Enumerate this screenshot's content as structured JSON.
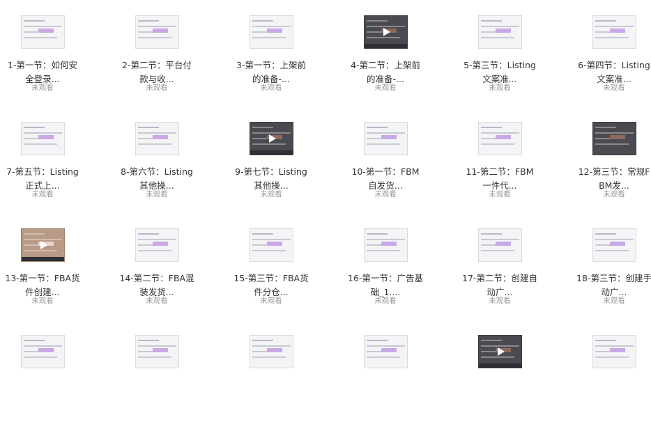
{
  "videos": [
    {
      "title": "1-第一节：如何安全登录...",
      "status": "未观看",
      "thumb": "light"
    },
    {
      "title": "2-第二节：平台付款与收...",
      "status": "未观看",
      "thumb": "light"
    },
    {
      "title": "3-第一节：上架前的准备-...",
      "status": "未观看",
      "thumb": "light"
    },
    {
      "title": "4-第二节：上架前的准备-...",
      "status": "未观看",
      "thumb": "dark-play"
    },
    {
      "title": "5-第三节：Listing文案准...",
      "status": "未观看",
      "thumb": "light"
    },
    {
      "title": "6-第四节：Listing文案准...",
      "status": "未观看",
      "thumb": "light"
    },
    {
      "title": "7-第五节：Listing正式上...",
      "status": "未观看",
      "thumb": "light"
    },
    {
      "title": "8-第六节：Listing其他操...",
      "status": "未观看",
      "thumb": "light"
    },
    {
      "title": "9-第七节：Listing其他操...",
      "status": "未观看",
      "thumb": "dark-play"
    },
    {
      "title": "10-第一节：FBM自发货...",
      "status": "未观看",
      "thumb": "light"
    },
    {
      "title": "11-第二节：FBM一件代...",
      "status": "未观看",
      "thumb": "light"
    },
    {
      "title": "12-第三节：常规FBM发...",
      "status": "未观看",
      "thumb": "dark"
    },
    {
      "title": "13-第一节：FBA货件创建...",
      "status": "未观看",
      "thumb": "photo-play"
    },
    {
      "title": "14-第二节：FBA混装发货...",
      "status": "未观看",
      "thumb": "light"
    },
    {
      "title": "15-第三节：FBA货件分仓...",
      "status": "未观看",
      "thumb": "light"
    },
    {
      "title": "16-第一节：广告基础_1....",
      "status": "未观看",
      "thumb": "light"
    },
    {
      "title": "17-第二节：创建自动广...",
      "status": "未观看",
      "thumb": "light"
    },
    {
      "title": "18-第三节：创建手动广...",
      "status": "未观看",
      "thumb": "light"
    },
    {
      "title": "",
      "status": "",
      "thumb": "light"
    },
    {
      "title": "",
      "status": "",
      "thumb": "light"
    },
    {
      "title": "",
      "status": "",
      "thumb": "light"
    },
    {
      "title": "",
      "status": "",
      "thumb": "light"
    },
    {
      "title": "",
      "status": "",
      "thumb": "dark-play"
    },
    {
      "title": "",
      "status": "",
      "thumb": "light"
    }
  ]
}
